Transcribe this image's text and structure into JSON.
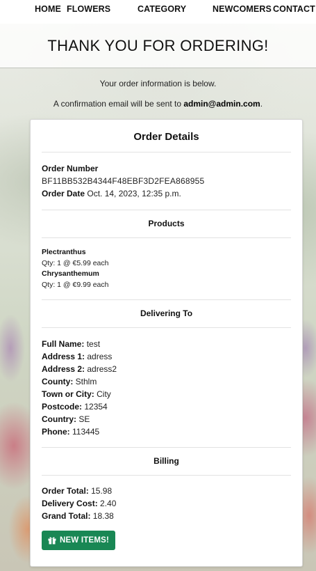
{
  "nav": {
    "home": "HOME",
    "flowers": "FLOWERS",
    "category": "CATEGORY",
    "newcomers": "NEWCOMERS",
    "contact": "CONTACT"
  },
  "header": {
    "title": "THANK YOU FOR ORDERING!"
  },
  "info": {
    "line1": "Your order information is below.",
    "line2_prefix": "A confirmation email will be sent to ",
    "email": "admin@admin.com",
    "line2_suffix": "."
  },
  "order_details": {
    "title": "Order Details",
    "order_number_label": "Order Number",
    "order_number": "BF11BB532B4344F48EBF3D2FEA868955",
    "order_date_label": "Order Date",
    "order_date": "Oct. 14, 2023, 12:35 p.m."
  },
  "products": {
    "title": "Products",
    "items": [
      {
        "name": "Plectranthus",
        "qty": "Qty: 1 @ €5.99 each"
      },
      {
        "name": "Chrysanthemum",
        "qty": "Qty: 1 @ €9.99 each"
      }
    ]
  },
  "delivery": {
    "title": "Delivering To",
    "fields": [
      {
        "label": "Full Name:",
        "value": "test"
      },
      {
        "label": "Address 1:",
        "value": "adress"
      },
      {
        "label": "Address 2:",
        "value": "adress2"
      },
      {
        "label": "County:",
        "value": "Sthlm"
      },
      {
        "label": "Town or City:",
        "value": "City"
      },
      {
        "label": "Postcode:",
        "value": "12354"
      },
      {
        "label": "Country:",
        "value": "SE"
      },
      {
        "label": "Phone:",
        "value": "113445"
      }
    ]
  },
  "billing": {
    "title": "Billing",
    "fields": [
      {
        "label": "Order Total:",
        "value": "15.98"
      },
      {
        "label": "Delivery Cost:",
        "value": "2.40"
      },
      {
        "label": "Grand Total:",
        "value": "18.38"
      }
    ]
  },
  "cta": {
    "label": "NEW ITEMS!",
    "icon": "gift-icon"
  },
  "colors": {
    "button": "#198754"
  }
}
